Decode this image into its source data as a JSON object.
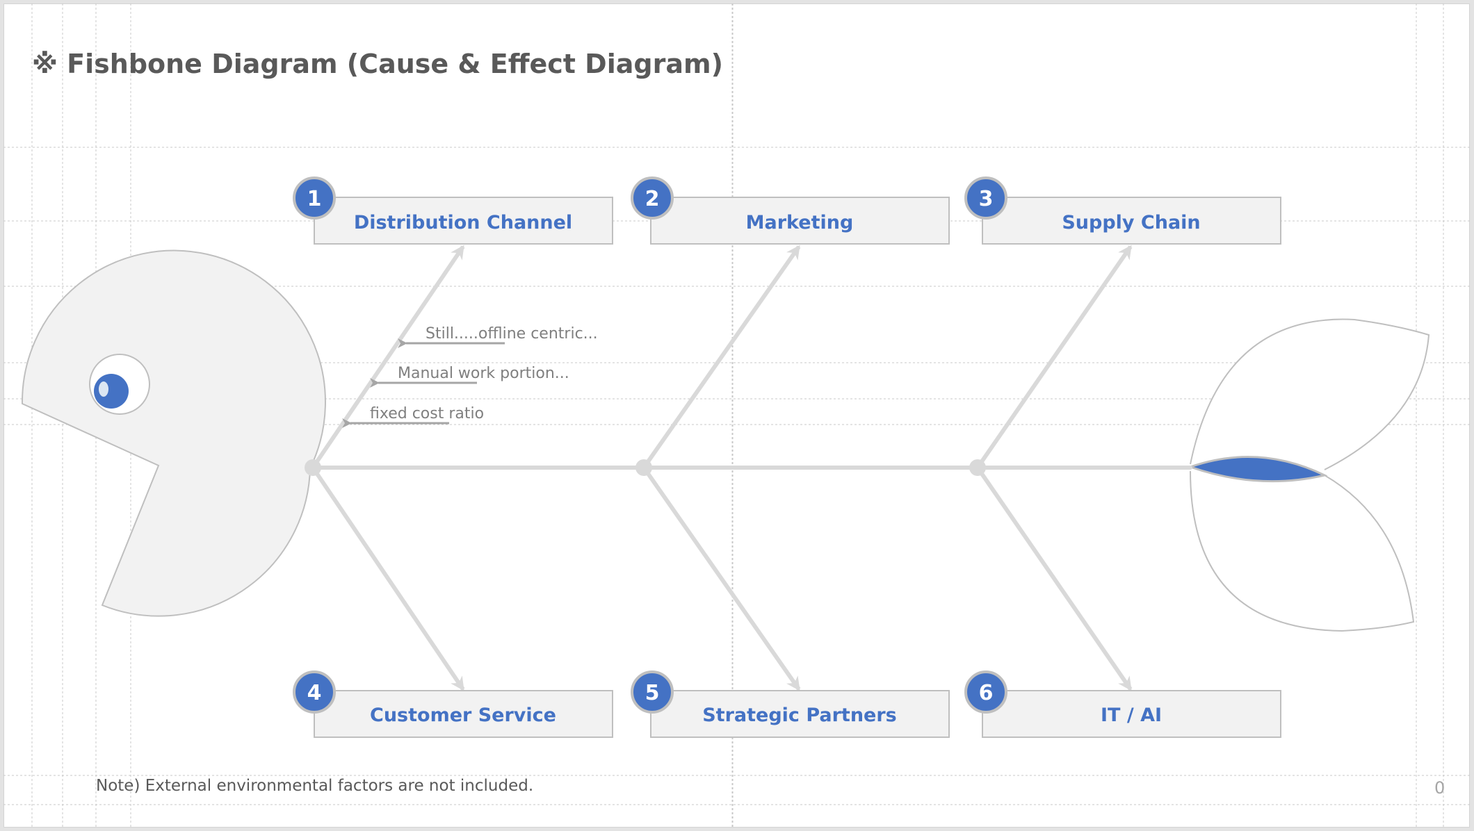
{
  "title": "※ Fishbone Diagram (Cause & Effect Diagram)",
  "note": "Note) External environmental factors are not included.",
  "page_number": "0",
  "colors": {
    "accent_blue": "#4472c4",
    "bone_gray": "#d9d9d9",
    "outline_gray": "#bfbfbf",
    "fill_gray": "#f2f2f2",
    "text_gray": "#595959"
  },
  "categories": [
    {
      "number": "1",
      "label": "Distribution Channel"
    },
    {
      "number": "2",
      "label": "Marketing"
    },
    {
      "number": "3",
      "label": "Supply Chain"
    },
    {
      "number": "4",
      "label": "Customer Service"
    },
    {
      "number": "5",
      "label": "Strategic Partners"
    },
    {
      "number": "6",
      "label": "IT / AI"
    }
  ],
  "causes": [
    "Still.....offline centric...",
    "Manual work portion...",
    "fixed cost ratio"
  ],
  "icons": {
    "head": "fish-head-icon",
    "eye": "fish-eye-icon",
    "tail": "fish-tail-icon"
  }
}
